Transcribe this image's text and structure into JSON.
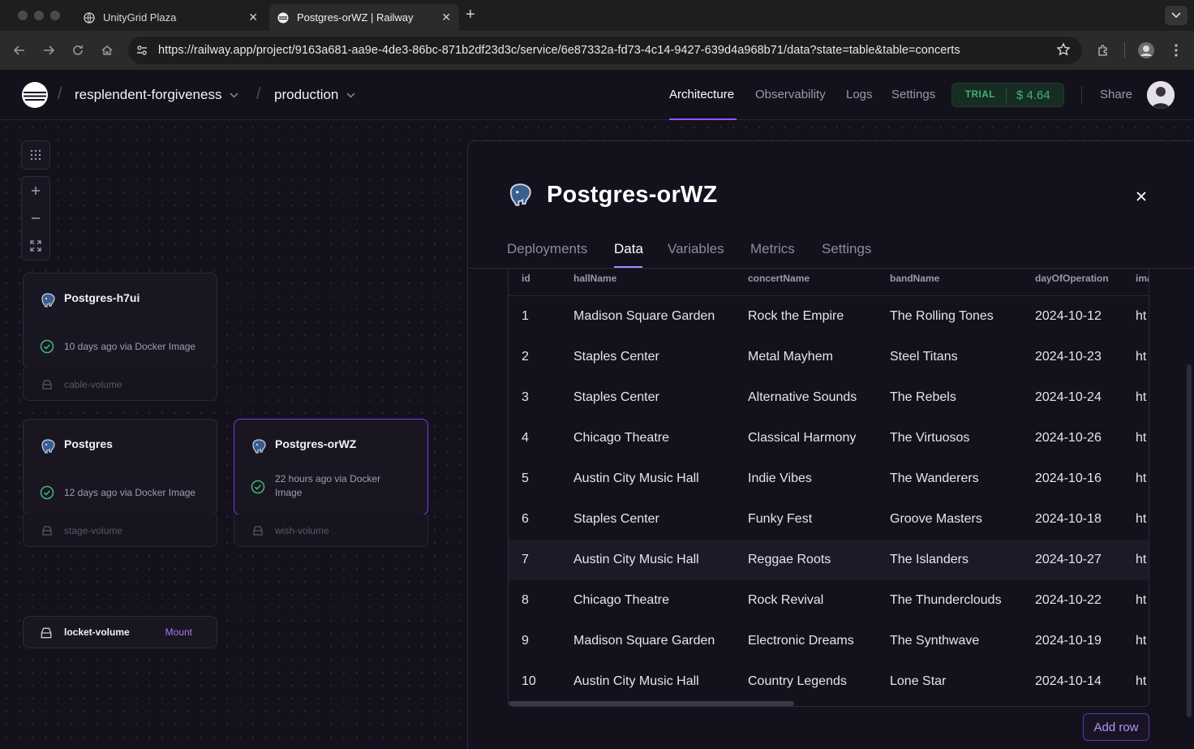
{
  "browser": {
    "tabs": [
      {
        "title": "UnityGrid Plaza",
        "active": false
      },
      {
        "title": "Postgres-orWZ | Railway",
        "active": true
      }
    ],
    "url": "https://railway.app/project/9163a681-aa9e-4de3-86bc-871b2df23d3c/service/6e87332a-fd73-4c14-9427-639d4a968b71/data?state=table&table=concerts"
  },
  "nav": {
    "project": "resplendent-forgiveness",
    "environment": "production",
    "links": [
      "Architecture",
      "Observability",
      "Logs",
      "Settings"
    ],
    "active_link": "Architecture",
    "trial_label": "TRIAL",
    "trial_amount": "$ 4.64",
    "share": "Share"
  },
  "canvas": {
    "services": [
      {
        "name": "Postgres-h7ui",
        "status": "10 days ago via Docker Image",
        "volume": "cable-volume",
        "selected": false
      },
      {
        "name": "Postgres",
        "status": "12 days ago via Docker Image",
        "volume": "stage-volume",
        "selected": false
      },
      {
        "name": "Postgres-orWZ",
        "status": "22 hours ago via Docker Image",
        "volume": "wish-volume",
        "selected": true
      }
    ],
    "unattached_volume": {
      "name": "locket-volume",
      "action": "Mount"
    }
  },
  "panel": {
    "title": "Postgres-orWZ",
    "tabs": [
      "Deployments",
      "Data",
      "Variables",
      "Metrics",
      "Settings"
    ],
    "active_tab": "Data",
    "table": {
      "columns": [
        "id",
        "hallName",
        "concertName",
        "bandName",
        "dayOfOperation",
        "ima"
      ],
      "rows": [
        [
          "1",
          "Madison Square Garden",
          "Rock the Empire",
          "The Rolling Tones",
          "2024-10-12",
          "ht"
        ],
        [
          "2",
          "Staples Center",
          "Metal Mayhem",
          "Steel Titans",
          "2024-10-23",
          "ht"
        ],
        [
          "3",
          "Staples Center",
          "Alternative Sounds",
          "The Rebels",
          "2024-10-24",
          "ht"
        ],
        [
          "4",
          "Chicago Theatre",
          "Classical Harmony",
          "The Virtuosos",
          "2024-10-26",
          "ht"
        ],
        [
          "5",
          "Austin City Music Hall",
          "Indie Vibes",
          "The Wanderers",
          "2024-10-16",
          "ht"
        ],
        [
          "6",
          "Staples Center",
          "Funky Fest",
          "Groove Masters",
          "2024-10-18",
          "ht"
        ],
        [
          "7",
          "Austin City Music Hall",
          "Reggae Roots",
          "The Islanders",
          "2024-10-27",
          "ht"
        ],
        [
          "8",
          "Chicago Theatre",
          "Rock Revival",
          "The Thunderclouds",
          "2024-10-22",
          "ht"
        ],
        [
          "9",
          "Madison Square Garden",
          "Electronic Dreams",
          "The Synthwave",
          "2024-10-19",
          "ht"
        ],
        [
          "10",
          "Austin City Music Hall",
          "Country Legends",
          "Lone Star",
          "2024-10-14",
          "ht"
        ]
      ],
      "highlighted_row": 7
    },
    "add_row": "Add row"
  },
  "colors": {
    "accent": "#8b5cf6",
    "trial_green": "#3fb777",
    "background": "#13111c"
  }
}
